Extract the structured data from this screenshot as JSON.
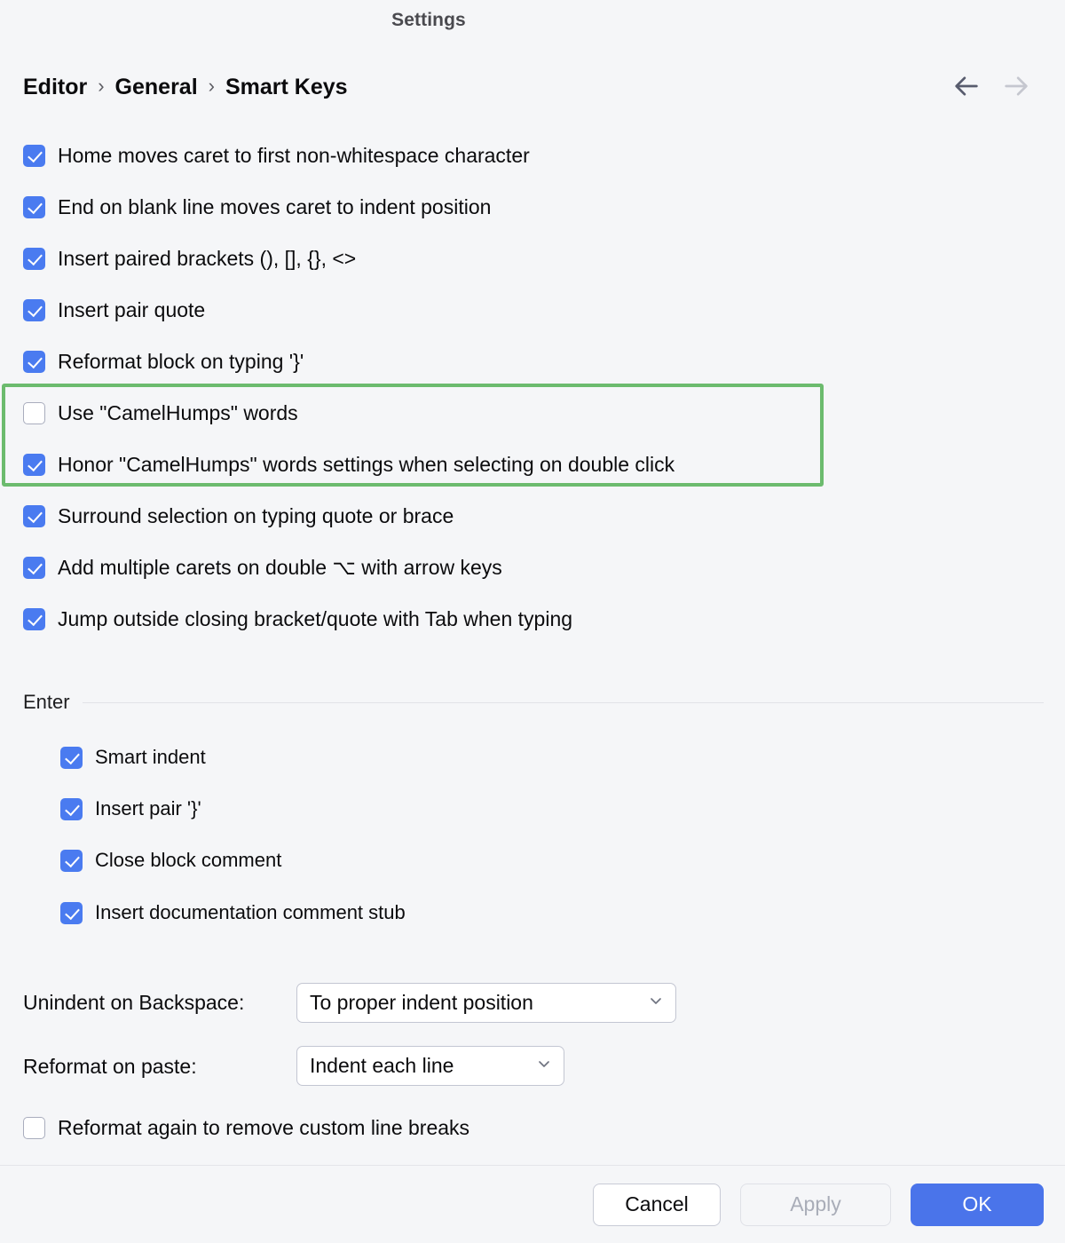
{
  "dialog": {
    "title": "Settings",
    "accent_blue": "#4a7bf0",
    "ok_blue": "#4a74ea",
    "highlight_green": "#6cbb6e",
    "background": "#f5f6f8"
  },
  "breadcrumb": {
    "items": [
      "Editor",
      "General",
      "Smart Keys"
    ],
    "separator": "›"
  },
  "nav": {
    "back_label": "back-arrow",
    "forward_label": "forward-arrow",
    "back_enabled": true,
    "forward_enabled": false
  },
  "options": [
    {
      "label": "Home moves caret to first non-whitespace character",
      "checked": true
    },
    {
      "label": "End on blank line moves caret to indent position",
      "checked": true
    },
    {
      "label": "Insert paired brackets (), [], {}, <>",
      "checked": true
    },
    {
      "label": "Insert pair quote",
      "checked": true
    },
    {
      "label": "Reformat block on typing '}'",
      "checked": true
    },
    {
      "label": "Use \"CamelHumps\" words",
      "checked": false
    },
    {
      "label": "Honor \"CamelHumps\" words settings when selecting on double click",
      "checked": true
    },
    {
      "label": "Surround selection on typing quote or brace",
      "checked": true
    },
    {
      "label": "Add multiple carets on double ⌥ with arrow keys",
      "checked": true
    },
    {
      "label": "Jump outside closing bracket/quote with Tab when typing",
      "checked": true
    }
  ],
  "enter_group": {
    "title": "Enter",
    "options": [
      {
        "label": "Smart indent",
        "checked": true
      },
      {
        "label": "Insert pair '}'",
        "checked": true
      },
      {
        "label": "Close block comment",
        "checked": true
      },
      {
        "label": "Insert documentation comment stub",
        "checked": true
      }
    ]
  },
  "selects": [
    {
      "label": "Unindent on Backspace:",
      "value": "To proper indent position"
    },
    {
      "label": "Reformat on paste:",
      "value": "Indent each line"
    }
  ],
  "trailing_option": {
    "label": "Reformat again to remove custom line breaks",
    "checked": false
  },
  "buttons": {
    "cancel": "Cancel",
    "apply": "Apply",
    "ok": "OK",
    "apply_enabled": false
  }
}
